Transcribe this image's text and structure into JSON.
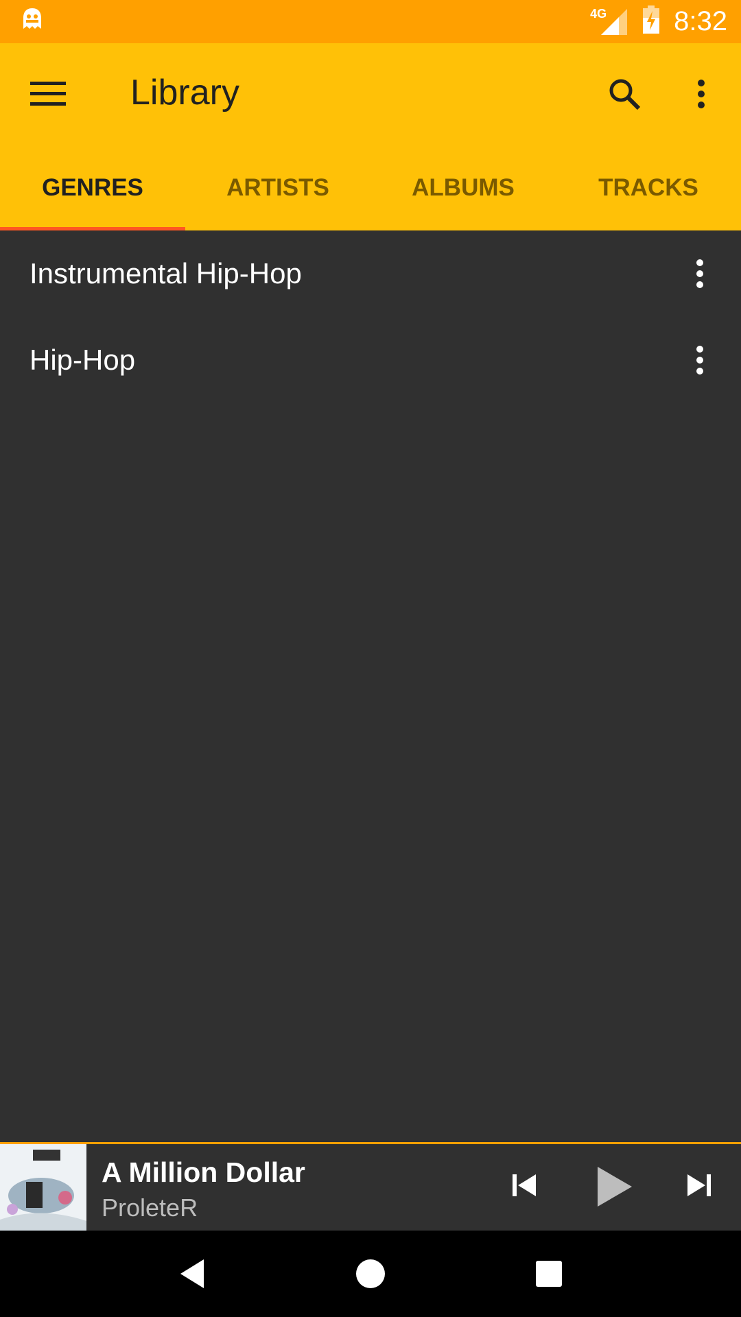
{
  "status_bar": {
    "network": "4G",
    "time": "8:32"
  },
  "toolbar": {
    "title": "Library"
  },
  "tabs": [
    {
      "label": "GENRES",
      "active": true
    },
    {
      "label": "ARTISTS",
      "active": false
    },
    {
      "label": "ALBUMS",
      "active": false
    },
    {
      "label": "TRACKS",
      "active": false
    }
  ],
  "genres": [
    {
      "label": "Instrumental Hip-Hop"
    },
    {
      "label": "Hip-Hop"
    }
  ],
  "now_playing": {
    "title": "A Million Dollar",
    "artist": "ProleteR"
  },
  "colors": {
    "status_bar": "#FFA000",
    "toolbar": "#FFC107",
    "tab_indicator": "#FF5722",
    "background": "#303030"
  }
}
